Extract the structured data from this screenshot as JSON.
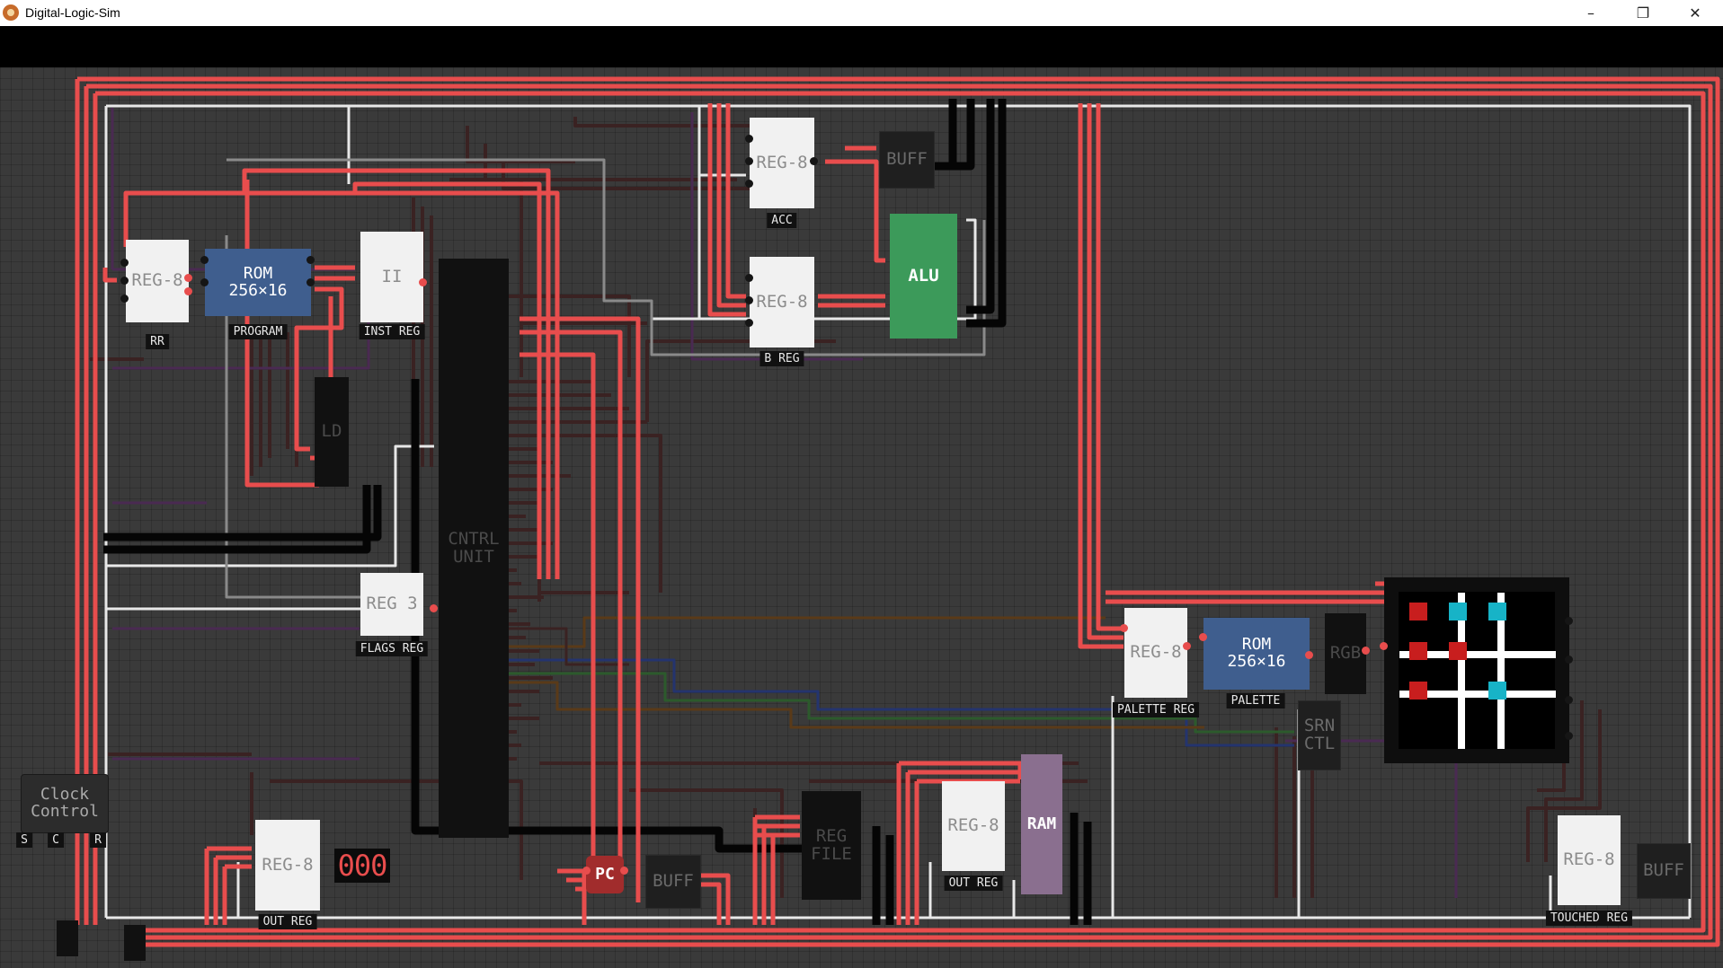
{
  "window": {
    "title": "Digital-Logic-Sim",
    "minimize_icon": "minimize-icon",
    "restore_icon": "restore-icon",
    "close_icon": "close-icon"
  },
  "chips": {
    "rr_reg": {
      "name": "REG-8",
      "label": "RR"
    },
    "program_rom": {
      "name": "ROM\n256×16",
      "label": "PROGRAM"
    },
    "inst_reg": {
      "name": "II",
      "label": "INST REG"
    },
    "ld": {
      "name": "LD"
    },
    "cntrl_unit": {
      "name": "CNTRL\nUNIT"
    },
    "flags_reg": {
      "name": "REG 3",
      "label": "FLAGS REG"
    },
    "acc_reg": {
      "name": "REG-8",
      "label": "ACC"
    },
    "b_reg": {
      "name": "REG-8",
      "label": "B REG"
    },
    "buff_top": {
      "name": "BUFF"
    },
    "alu": {
      "name": "ALU"
    },
    "clock_control": {
      "name": "Clock\nControl",
      "pin_s": "S",
      "pin_c": "C",
      "pin_r": "R"
    },
    "out_reg_left": {
      "name": "REG-8",
      "label": "OUT REG",
      "display_value": "000"
    },
    "pc": {
      "name": "PC"
    },
    "buff_pc": {
      "name": "BUFF"
    },
    "reg_file": {
      "name": "REG\nFILE"
    },
    "out_reg_mid": {
      "name": "REG-8",
      "label": "OUT REG"
    },
    "ram": {
      "name": "RAM"
    },
    "palette_reg": {
      "name": "REG-8",
      "label": "PALETTE REG"
    },
    "palette_rom": {
      "name": "ROM\n256×16",
      "label": "PALETTE"
    },
    "rgb": {
      "name": "RGB"
    },
    "srn_ctl": {
      "name": "SRN\nCTL"
    },
    "touched_reg": {
      "name": "REG-8",
      "label": "TOUCHED REG"
    },
    "buff_right": {
      "name": "BUFF"
    }
  },
  "screen": {
    "grid": [
      [
        "red",
        "cyan",
        "cyan"
      ],
      [
        "red",
        "red",
        "empty"
      ],
      [
        "red",
        "empty",
        "cyan"
      ]
    ],
    "colors": {
      "red": "#c81e1e",
      "cyan": "#17b3c7",
      "empty": "#000000",
      "grid_line": "#ffffff"
    }
  },
  "colors": {
    "wire_on": "#e84d4d",
    "wire_off": "#3a2222",
    "bus_white": "#e8e8e8",
    "bus_purple": "#4a2a52",
    "bus_blue": "#24346e",
    "bus_green": "#2c5a2c",
    "bus_orange": "#5a3a18",
    "rom_blue": "#3f5e8e",
    "alu_green": "#3c9a5a",
    "ram_purple": "#8a6f8f",
    "pc_red": "#a12c2c"
  }
}
